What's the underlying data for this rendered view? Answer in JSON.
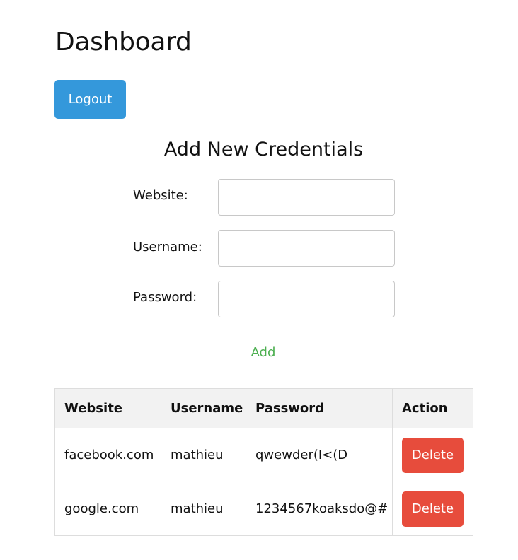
{
  "header": {
    "title": "Dashboard",
    "logout_label": "Logout"
  },
  "form": {
    "title": "Add New Credentials",
    "website_label": "Website:",
    "website_value": "",
    "username_label": "Username:",
    "username_value": "",
    "password_label": "Password:",
    "password_value": "",
    "add_label": "Add"
  },
  "table": {
    "columns": [
      "Website",
      "Username",
      "Password",
      "Action"
    ],
    "rows": [
      {
        "website": "facebook.com",
        "username": "mathieu",
        "password": "qwewder(I<(D",
        "action_label": "Delete"
      },
      {
        "website": "google.com",
        "username": "mathieu",
        "password": "1234567koaksdo@#",
        "action_label": "Delete"
      }
    ]
  },
  "colors": {
    "logout_button": "#3498db",
    "add_button_text": "#4caf50",
    "delete_button": "#e74c3c",
    "table_header_bg": "#f2f2f2"
  }
}
